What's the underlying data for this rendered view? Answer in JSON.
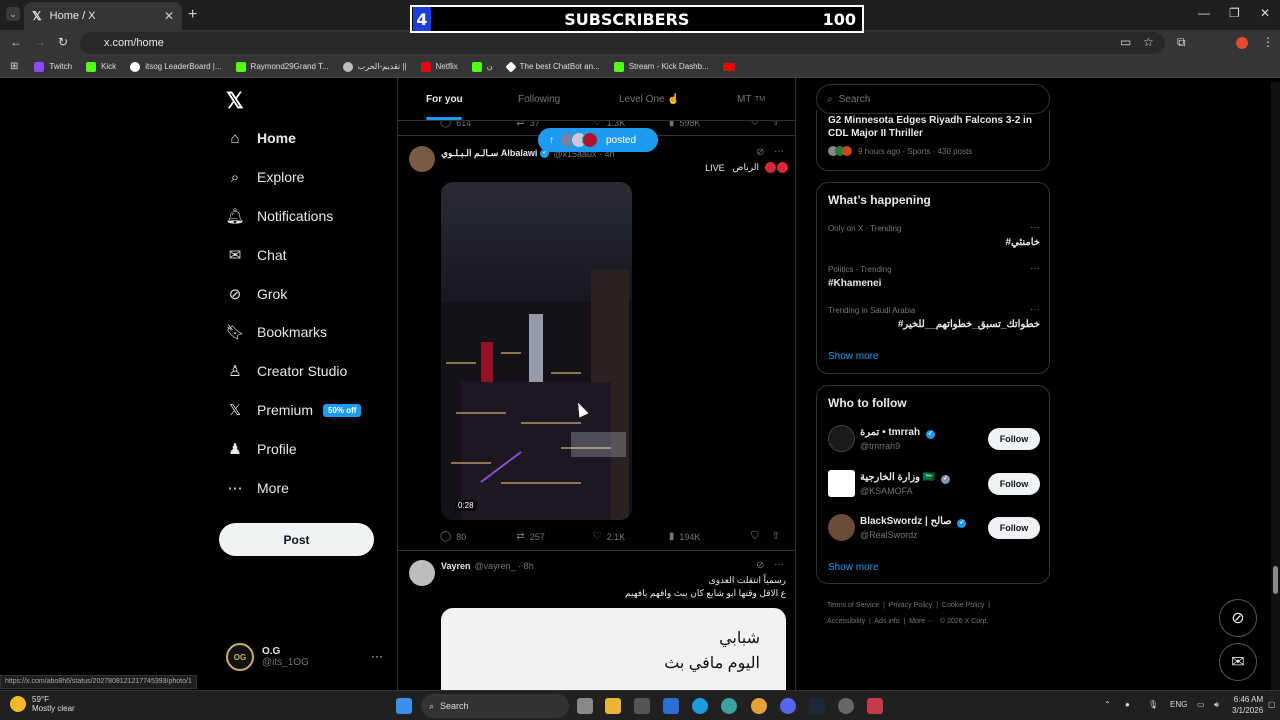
{
  "browser": {
    "tab_title": "Home / X",
    "url": "x.com/home",
    "bookmarks": [
      {
        "label": "Twitch",
        "color": "#9146ff"
      },
      {
        "label": "Kick",
        "color": "#53fc18"
      },
      {
        "label": "itsog LeaderBoard |...",
        "color": "#ffffff"
      },
      {
        "label": "Raymond29Grand T...",
        "color": "#53fc18"
      },
      {
        "label": "تقديم-الحرب ||",
        "color": "#bbbbbb"
      },
      {
        "label": "Netflix",
        "color": "#e50914"
      },
      {
        "label": "ن",
        "color": "#53fc18"
      },
      {
        "label": "The best ChatBot an...",
        "color": "#ffffff"
      },
      {
        "label": "Stream - Kick Dashb...",
        "color": "#53fc18"
      }
    ]
  },
  "overlay": {
    "count": "4",
    "title": "SUBSCRIBERS",
    "goal": "100"
  },
  "nav": {
    "items": [
      {
        "label": "Home"
      },
      {
        "label": "Explore"
      },
      {
        "label": "Notifications"
      },
      {
        "label": "Chat"
      },
      {
        "label": "Grok"
      },
      {
        "label": "Bookmarks"
      },
      {
        "label": "Creator Studio"
      },
      {
        "label": "Premium",
        "badge": "50% off"
      },
      {
        "label": "Profile"
      },
      {
        "label": "More"
      }
    ],
    "post_label": "Post",
    "account": {
      "name": "O.G",
      "handle": "@its_1OG",
      "avatar_text": "OG"
    }
  },
  "feed": {
    "tabs": [
      "For you",
      "Following",
      "Level One ☝️",
      "MT"
    ],
    "tab_extra": "TM",
    "posted_pill": "posted",
    "prev_post_stats": {
      "replies": "614",
      "reposts": "37",
      "likes": "1.3K",
      "views": "598K"
    },
    "post1": {
      "name": "سـالـم الـبـلـوي Albalawi",
      "handle": "@x15aaux · 4h",
      "text_right": "الرياض",
      "live": "LIVE",
      "video_time": "0:28",
      "stats": {
        "replies": "80",
        "reposts": "257",
        "likes": "2.1K",
        "views": "194K"
      }
    },
    "post2": {
      "name": "Vayren",
      "handle": "@vayren_ · 8h",
      "line1": "رسمياً انتقلت العدوى",
      "line2": "ع الاقل وقتها ابو شايع كان يبث وافهم يافهيم",
      "img_line1": "شبابي",
      "img_line2": "اليوم مافي بث"
    }
  },
  "right": {
    "search_placeholder": "Search",
    "top_story": {
      "title": "G2 Minnesota Edges Riyadh Falcons 3-2 in CDL Major II Thriller",
      "meta": "9 hours ago · Sports · 430 posts"
    },
    "happening_title": "What’s happening",
    "trends": [
      {
        "context": "Only on X · Trending",
        "tag": "#خامنئي"
      },
      {
        "context": "Politics · Trending",
        "tag": "#Khamenei"
      },
      {
        "context": "Trending in Saudi Arabia",
        "tag": "#خطواتك_تسبق_خطواتهم__للخير"
      }
    ],
    "show_more": "Show more",
    "wtf_title": "Who to follow",
    "follow": [
      {
        "name": "تمرة • tmrrah",
        "handle": "@tmrrah9",
        "color": "#1a1a1a"
      },
      {
        "name": "وزارة الخارجية 🇸🇦",
        "handle": "@KSAMOFA",
        "color": "#ffffff"
      },
      {
        "name": "BlackSwordz | صالح",
        "handle": "@RealSwordz",
        "color": "#6b4a3a"
      }
    ],
    "follow_label": "Follow",
    "footer": {
      "terms": "Terms of Service",
      "privacy": "Privacy Policy",
      "cookie": "Cookie Policy",
      "access": "Accessibility",
      "ads": "Ads info",
      "more": "More ···",
      "copy": "© 2026 X Corp."
    }
  },
  "status_url": "https://x.com/abo8h6/status/2027808121217745393/photo/1",
  "taskbar": {
    "temp": "59°F",
    "weather": "Mostly clear",
    "search": "Search",
    "lang": "ENG",
    "time": "6:46 AM",
    "date": "3/1/2026"
  }
}
